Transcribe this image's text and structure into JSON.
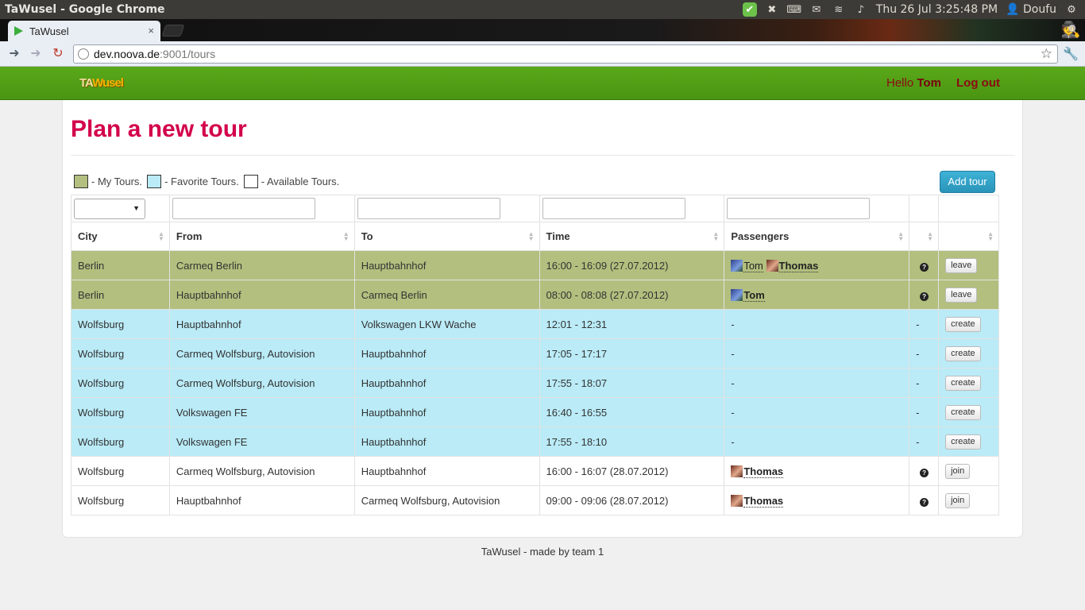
{
  "os": {
    "window_title": "TaWusel - Google Chrome",
    "clock": "Thu 26 Jul  3:25:48 PM",
    "user": "Doufu"
  },
  "browser": {
    "tab_title": "TaWusel",
    "tab_close": "×",
    "url_host": "dev.noova.de",
    "url_path": ":9001/tours"
  },
  "app": {
    "brand_ta": "TA",
    "brand_wusel": "Wusel",
    "hello": "Hello",
    "user_name": "Tom",
    "logout": "Log out"
  },
  "page": {
    "title": "Plan a new tour",
    "add_tour": "Add tour",
    "legend": {
      "mine": "- My Tours.",
      "favorite": "- Favorite Tours.",
      "available": "- Available Tours."
    },
    "legend_colors": {
      "mine": "#b2bf7e",
      "favorite": "#baebf7",
      "available": "#ffffff"
    }
  },
  "table": {
    "headers": {
      "city": "City",
      "from": "From",
      "to": "To",
      "time": "Time",
      "passengers": "Passengers"
    },
    "rows": [
      {
        "type": "mine",
        "city": "Berlin",
        "from": "Carmeq Berlin",
        "to": "Hauptbahnhof",
        "time": "16:00 - 16:09 (27.07.2012)",
        "p1": "Tom",
        "p2": "Thomas",
        "info": "?",
        "action": "leave"
      },
      {
        "type": "mine",
        "city": "Berlin",
        "from": "Hauptbahnhof",
        "to": "Carmeq Berlin",
        "time": "08:00 - 08:08 (27.07.2012)",
        "p1": "Tom",
        "info": "?",
        "action": "leave"
      },
      {
        "type": "fav",
        "city": "Wolfsburg",
        "from": "Hauptbahnhof",
        "to": "Volkswagen LKW Wache",
        "time": "12:01 - 12:31",
        "passengers": "-",
        "info": "-",
        "action": "create"
      },
      {
        "type": "fav",
        "city": "Wolfsburg",
        "from": "Carmeq Wolfsburg, Autovision",
        "to": "Hauptbahnhof",
        "time": "17:05 - 17:17",
        "passengers": "-",
        "info": "-",
        "action": "create"
      },
      {
        "type": "fav",
        "city": "Wolfsburg",
        "from": "Carmeq Wolfsburg, Autovision",
        "to": "Hauptbahnhof",
        "time": "17:55 - 18:07",
        "passengers": "-",
        "info": "-",
        "action": "create"
      },
      {
        "type": "fav",
        "city": "Wolfsburg",
        "from": "Volkswagen FE",
        "to": "Hauptbahnhof",
        "time": "16:40 - 16:55",
        "passengers": "-",
        "info": "-",
        "action": "create"
      },
      {
        "type": "fav",
        "city": "Wolfsburg",
        "from": "Volkswagen FE",
        "to": "Hauptbahnhof",
        "time": "17:55 - 18:10",
        "passengers": "-",
        "info": "-",
        "action": "create"
      },
      {
        "type": "avail",
        "city": "Wolfsburg",
        "from": "Carmeq Wolfsburg, Autovision",
        "to": "Hauptbahnhof",
        "time": "16:00 - 16:07 (28.07.2012)",
        "p1": "Thomas",
        "info": "?",
        "action": "join"
      },
      {
        "type": "avail",
        "city": "Wolfsburg",
        "from": "Hauptbahnhof",
        "to": "Carmeq Wolfsburg, Autovision",
        "time": "09:00 - 09:06 (28.07.2012)",
        "p1": "Thomas",
        "info": "?",
        "action": "join"
      }
    ]
  },
  "footer": "TaWusel - made by team 1"
}
